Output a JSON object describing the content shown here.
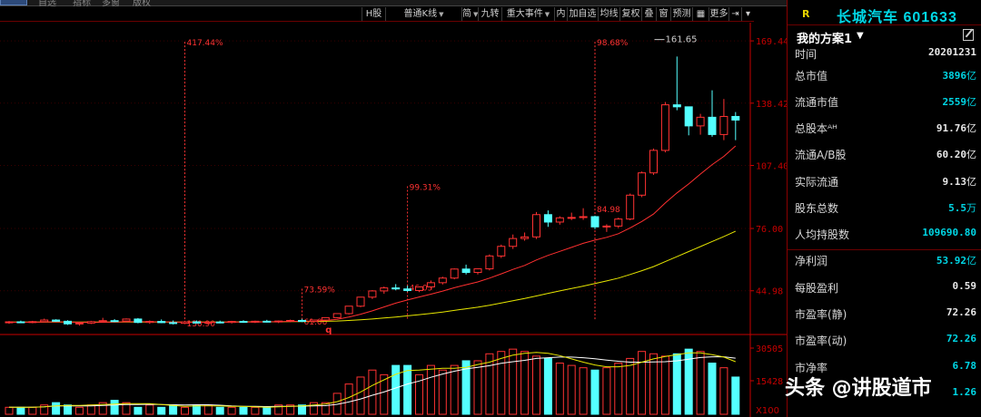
{
  "topbar": {
    "items": [
      "自选",
      "指标",
      "多窗",
      "版权"
    ]
  },
  "toolbar": {
    "buttons": [
      {
        "label": "H股",
        "dropdown": false
      },
      {
        "label": "普通K线",
        "dropdown": true
      },
      {
        "label": "简",
        "dropdown": true
      },
      {
        "label": "九转",
        "dropdown": false
      },
      {
        "label": "重大事件",
        "dropdown": true
      },
      {
        "label": "内",
        "dropdown": false
      },
      {
        "label": "加自选",
        "dropdown": false
      },
      {
        "label": "均线",
        "dropdown": false
      },
      {
        "label": "复权",
        "dropdown": false
      },
      {
        "label": "叠",
        "dropdown": false
      },
      {
        "label": "窗",
        "dropdown": false
      },
      {
        "label": "预测",
        "dropdown": false
      },
      {
        "label": "更多",
        "dropdown": false
      }
    ]
  },
  "chart_data": [
    {
      "type": "candlestick",
      "price_axis_ticks": [
        "169.44",
        "138.42",
        "107.40",
        "76.00",
        "44.98"
      ],
      "ylim": [
        25,
        174
      ],
      "annotations": [
        {
          "text": "417.44%",
          "x": 15,
          "y": 169
        },
        {
          "text": "130.90",
          "x": 15,
          "y": 29
        },
        {
          "text": "73.59%",
          "x": 25,
          "y": 46
        },
        {
          "text": "61.06",
          "x": 25,
          "y": 30
        },
        {
          "text": "99.31%",
          "x": 34,
          "y": 97
        },
        {
          "text": "46.05",
          "x": 34,
          "y": 47
        },
        {
          "text": "98.68%",
          "x": 50,
          "y": 169
        },
        {
          "text": "84.98",
          "x": 50,
          "y": 86
        },
        {
          "text": "161.65",
          "x": 55,
          "y": 171
        }
      ],
      "event_marker": "q",
      "candles": [
        {
          "o": 29.2,
          "h": 29.9,
          "l": 28.5,
          "c": 29.5
        },
        {
          "o": 29.5,
          "h": 30.1,
          "l": 28.9,
          "c": 29.3
        },
        {
          "o": 29.3,
          "h": 30.0,
          "l": 28.8,
          "c": 29.6
        },
        {
          "o": 29.6,
          "h": 31.1,
          "l": 29.3,
          "c": 30.4
        },
        {
          "o": 30.4,
          "h": 30.8,
          "l": 29.5,
          "c": 29.8
        },
        {
          "o": 29.8,
          "h": 30.3,
          "l": 28.0,
          "c": 28.5
        },
        {
          "o": 28.5,
          "h": 29.3,
          "l": 27.6,
          "c": 28.9
        },
        {
          "o": 28.9,
          "h": 30.0,
          "l": 28.4,
          "c": 29.6
        },
        {
          "o": 29.6,
          "h": 31.5,
          "l": 29.2,
          "c": 30.1
        },
        {
          "o": 30.1,
          "h": 30.9,
          "l": 29.4,
          "c": 29.9
        },
        {
          "o": 29.9,
          "h": 31.2,
          "l": 29.5,
          "c": 30.9
        },
        {
          "o": 30.9,
          "h": 31.4,
          "l": 28.8,
          "c": 29.2
        },
        {
          "o": 29.2,
          "h": 30.2,
          "l": 28.5,
          "c": 29.7
        },
        {
          "o": 29.7,
          "h": 30.7,
          "l": 28.9,
          "c": 29.1
        },
        {
          "o": 29.1,
          "h": 30.2,
          "l": 28.2,
          "c": 28.8
        },
        {
          "o": 28.8,
          "h": 30.0,
          "l": 28.4,
          "c": 29.5
        },
        {
          "o": 29.5,
          "h": 30.2,
          "l": 28.7,
          "c": 28.9
        },
        {
          "o": 28.9,
          "h": 29.8,
          "l": 28.3,
          "c": 29.4
        },
        {
          "o": 29.4,
          "h": 30.1,
          "l": 28.8,
          "c": 29.2
        },
        {
          "o": 29.2,
          "h": 30.0,
          "l": 28.7,
          "c": 29.7
        },
        {
          "o": 29.7,
          "h": 30.3,
          "l": 29.0,
          "c": 29.4
        },
        {
          "o": 29.4,
          "h": 30.1,
          "l": 28.9,
          "c": 29.8
        },
        {
          "o": 29.8,
          "h": 30.5,
          "l": 29.2,
          "c": 29.5
        },
        {
          "o": 29.5,
          "h": 30.2,
          "l": 28.9,
          "c": 29.9
        },
        {
          "o": 29.9,
          "h": 30.6,
          "l": 29.3,
          "c": 30.2
        },
        {
          "o": 30.2,
          "h": 31.0,
          "l": 29.4,
          "c": 29.7
        },
        {
          "o": 29.7,
          "h": 30.5,
          "l": 29.0,
          "c": 30.4
        },
        {
          "o": 30.4,
          "h": 31.5,
          "l": 30.0,
          "c": 31.6
        },
        {
          "o": 31.6,
          "h": 33.4,
          "l": 31.3,
          "c": 33.6
        },
        {
          "o": 33.6,
          "h": 37.0,
          "l": 33.2,
          "c": 37.3
        },
        {
          "o": 37.3,
          "h": 42.0,
          "l": 36.8,
          "c": 41.8
        },
        {
          "o": 41.8,
          "h": 45.3,
          "l": 40.9,
          "c": 44.9
        },
        {
          "o": 44.9,
          "h": 47.1,
          "l": 43.5,
          "c": 46.4
        },
        {
          "o": 46.4,
          "h": 48.3,
          "l": 45.2,
          "c": 45.9
        },
        {
          "o": 45.9,
          "h": 47.5,
          "l": 44.5,
          "c": 45.1
        },
        {
          "o": 45.1,
          "h": 46.4,
          "l": 44.3,
          "c": 46.9
        },
        {
          "o": 46.9,
          "h": 50.1,
          "l": 45.9,
          "c": 49.0
        },
        {
          "o": 49.0,
          "h": 52.0,
          "l": 48.1,
          "c": 51.3
        },
        {
          "o": 51.3,
          "h": 56.1,
          "l": 50.7,
          "c": 55.8
        },
        {
          "o": 55.8,
          "h": 58.0,
          "l": 53.1,
          "c": 54.1
        },
        {
          "o": 54.1,
          "h": 56.0,
          "l": 53.1,
          "c": 55.9
        },
        {
          "o": 55.9,
          "h": 63.1,
          "l": 55.1,
          "c": 62.3
        },
        {
          "o": 62.3,
          "h": 68.0,
          "l": 61.3,
          "c": 67.1
        },
        {
          "o": 67.1,
          "h": 73.0,
          "l": 65.8,
          "c": 71.0
        },
        {
          "o": 71.0,
          "h": 74.0,
          "l": 69.9,
          "c": 71.8
        },
        {
          "o": 71.8,
          "h": 84.2,
          "l": 70.8,
          "c": 82.9
        },
        {
          "o": 82.9,
          "h": 85.0,
          "l": 76.8,
          "c": 79.2
        },
        {
          "o": 79.2,
          "h": 82.1,
          "l": 77.9,
          "c": 81.3
        },
        {
          "o": 81.3,
          "h": 83.9,
          "l": 80.2,
          "c": 81.5
        },
        {
          "o": 81.5,
          "h": 86.1,
          "l": 80.3,
          "c": 81.9
        },
        {
          "o": 81.9,
          "h": 82.4,
          "l": 75.7,
          "c": 76.8
        },
        {
          "o": 76.8,
          "h": 78.1,
          "l": 74.3,
          "c": 77.2
        },
        {
          "o": 77.2,
          "h": 81.4,
          "l": 76.2,
          "c": 80.7
        },
        {
          "o": 80.7,
          "h": 93.4,
          "l": 80.1,
          "c": 92.6
        },
        {
          "o": 92.6,
          "h": 104.4,
          "l": 91.6,
          "c": 103.7
        },
        {
          "o": 103.7,
          "h": 115.8,
          "l": 102.7,
          "c": 114.9
        },
        {
          "o": 114.9,
          "h": 139.0,
          "l": 113.9,
          "c": 137.6
        },
        {
          "o": 137.6,
          "h": 161.65,
          "l": 134.9,
          "c": 136.6
        },
        {
          "o": 136.6,
          "h": 133.1,
          "l": 122.4,
          "c": 127.1
        },
        {
          "o": 127.1,
          "h": 133.1,
          "l": 122.7,
          "c": 131.4
        },
        {
          "o": 131.4,
          "h": 144.8,
          "l": 121.7,
          "c": 122.8
        },
        {
          "o": 122.8,
          "h": 140.5,
          "l": 120.0,
          "c": 131.8
        },
        {
          "o": 131.8,
          "h": 134.0,
          "l": 120.0,
          "c": 130.0
        }
      ],
      "ma_fast": [
        29.3,
        29.3,
        29.3,
        29.4,
        29.5,
        29.4,
        29.3,
        29.2,
        29.3,
        29.4,
        29.5,
        29.6,
        29.5,
        29.5,
        29.4,
        29.3,
        29.3,
        29.3,
        29.3,
        29.4,
        29.4,
        29.4,
        29.5,
        29.6,
        29.7,
        29.8,
        29.9,
        30.2,
        30.8,
        31.9,
        33.3,
        35.0,
        36.9,
        38.8,
        40.4,
        41.9,
        43.3,
        44.8,
        46.5,
        48.0,
        49.4,
        51.3,
        53.4,
        55.6,
        57.6,
        60.3,
        62.6,
        64.6,
        66.6,
        68.6,
        70.2,
        71.6,
        73.4,
        76.3,
        79.5,
        83.2,
        88.7,
        93.7,
        98.2,
        103.1,
        107.8,
        111.9,
        117.1
      ],
      "ma_slow": [
        29.4,
        29.4,
        29.4,
        29.4,
        29.4,
        29.4,
        29.4,
        29.4,
        29.4,
        29.4,
        29.4,
        29.4,
        29.4,
        29.4,
        29.4,
        29.4,
        29.4,
        29.4,
        29.4,
        29.4,
        29.5,
        29.5,
        29.5,
        29.5,
        29.6,
        29.6,
        29.7,
        29.8,
        29.9,
        30.2,
        30.5,
        30.9,
        31.4,
        31.9,
        32.5,
        33.1,
        33.7,
        34.4,
        35.2,
        36.0,
        36.8,
        37.8,
        38.9,
        40.0,
        41.1,
        42.4,
        43.7,
        44.9,
        46.1,
        47.3,
        48.6,
        49.9,
        51.3,
        53.1,
        55.0,
        57.0,
        59.5,
        62.0,
        64.5,
        67.0,
        69.5,
        72.0,
        74.6
      ]
    },
    {
      "type": "volume",
      "axis_ticks": [
        "30505",
        "15428"
      ],
      "unit_label": "X100",
      "values": [
        3,
        3,
        3,
        4,
        5,
        4,
        3,
        4,
        5,
        6,
        5,
        3,
        4,
        3,
        4,
        3,
        4,
        4,
        3,
        3,
        3,
        3,
        3,
        4,
        4,
        4,
        5,
        5,
        9,
        13,
        16,
        19,
        17,
        21,
        21,
        17,
        21,
        19,
        21,
        23,
        23,
        26,
        27,
        28,
        27,
        25,
        24,
        22,
        21,
        20,
        19,
        20,
        22,
        24,
        27,
        26,
        25,
        26,
        28,
        27,
        22,
        20,
        16
      ],
      "direction": [
        "u",
        "d",
        "u",
        "u",
        "d",
        "d",
        "u",
        "u",
        "u",
        "d",
        "u",
        "d",
        "u",
        "d",
        "d",
        "u",
        "d",
        "u",
        "d",
        "u",
        "d",
        "u",
        "d",
        "u",
        "u",
        "d",
        "u",
        "u",
        "u",
        "u",
        "u",
        "u",
        "u",
        "d",
        "d",
        "u",
        "u",
        "u",
        "u",
        "d",
        "u",
        "u",
        "u",
        "u",
        "u",
        "u",
        "d",
        "u",
        "u",
        "u",
        "d",
        "u",
        "u",
        "u",
        "u",
        "u",
        "u",
        "d",
        "d",
        "u",
        "d",
        "u",
        "d"
      ]
    }
  ],
  "sidebar": {
    "r_marker": "R",
    "stock_name": "长城汽车 601633",
    "scheme_label": "我的方案1",
    "rows": [
      {
        "label": "时间",
        "value": "20201231",
        "unit": "",
        "cyan": false,
        "sep": false
      },
      {
        "label": "总市值",
        "value": "3896",
        "unit": "亿",
        "cyan": true,
        "sep": false
      },
      {
        "label": "流通市值",
        "value": "2559",
        "unit": "亿",
        "cyan": true,
        "sep": false
      },
      {
        "label": "总股本ᴬᴴ",
        "value": "91.76",
        "unit": "亿",
        "cyan": false,
        "sep": false
      },
      {
        "label": "流通A/B股",
        "value": "60.20",
        "unit": "亿",
        "cyan": false,
        "sep": false
      },
      {
        "label": "实际流通",
        "value": "9.13",
        "unit": "亿",
        "cyan": false,
        "sep": false
      },
      {
        "label": "股东总数",
        "value": "5.5",
        "unit": "万",
        "cyan": true,
        "sep": false
      },
      {
        "label": "人均持股数",
        "value": "109690.80",
        "unit": "",
        "cyan": true,
        "sep": false
      },
      {
        "label": "净利润",
        "value": "53.92",
        "unit": "亿",
        "cyan": true,
        "sep": true
      },
      {
        "label": "每股盈利",
        "value": "0.59",
        "unit": "",
        "cyan": false,
        "sep": false
      },
      {
        "label": "市盈率(静)",
        "value": "72.26",
        "unit": "",
        "cyan": false,
        "sep": false
      },
      {
        "label": "市盈率(动)",
        "value": "72.26",
        "unit": "",
        "cyan": true,
        "sep": false
      },
      {
        "label": "市净率",
        "value": "6.78",
        "unit": "",
        "cyan": true,
        "sep": false
      },
      {
        "label": "",
        "value": "1.26",
        "unit": "",
        "cyan": true,
        "sep": false
      }
    ]
  },
  "watermark": "头条 @讲股道市",
  "colors": {
    "up": "#ff3232",
    "down": "#54ffff",
    "ma_fast": "#ff3030",
    "ma_slow": "#e6e600",
    "axis": "#c80000"
  }
}
